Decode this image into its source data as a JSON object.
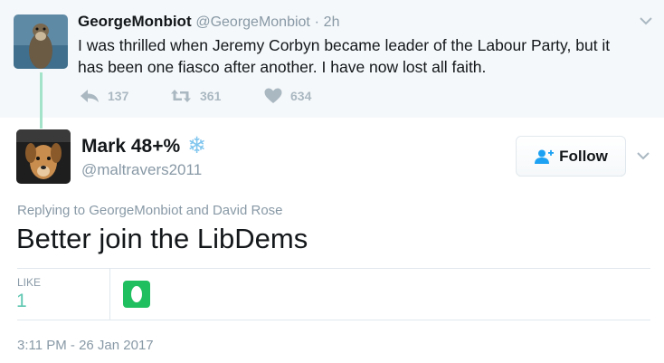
{
  "parent_tweet": {
    "display_name": "GeorgeMonbiot",
    "handle": "@GeorgeMonbiot",
    "separator": "·",
    "time": "2h",
    "text": "I was thrilled when Jeremy Corbyn became leader of the Labour Party, but it has been one fiasco after another. I have now lost all faith.",
    "actions": [
      {
        "icon": "reply-icon",
        "count": "137"
      },
      {
        "icon": "retweet-icon",
        "count": "361"
      },
      {
        "icon": "heart-icon",
        "count": "634"
      }
    ]
  },
  "main_tweet": {
    "display_name": "Mark 48+%",
    "name_emoji": "❄",
    "handle": "@maltravers2011",
    "follow_label": "Follow",
    "replying_to": "Replying to GeorgeMonbiot and David Rose",
    "text": "Better join the LibDems",
    "likes_label": "LIKE",
    "likes_count": "1",
    "timestamp": "3:11 PM - 26 Jan 2017"
  },
  "colors": {
    "accent_link": "#1da1f2",
    "muted_text": "#8899a6",
    "thread_line": "#a3e3c9",
    "like_count": "#5fc7b1",
    "snowflake": "#7fc5ee"
  }
}
